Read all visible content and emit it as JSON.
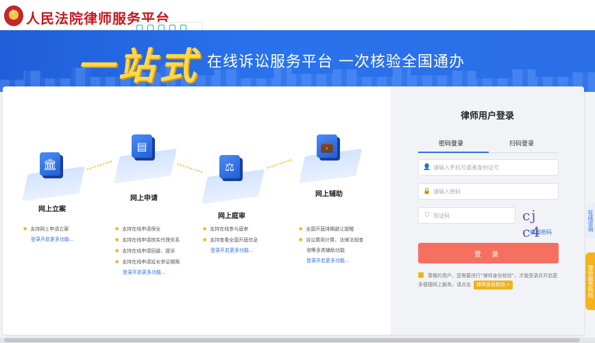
{
  "header": {
    "site_title": "人民法院律师服务平台"
  },
  "banner": {
    "slogan_big": "一站式",
    "slogan_small": "在线诉讼服务平台  一次核验全国通办"
  },
  "features": [
    {
      "title": "网上立案",
      "icon": "bank-icon",
      "bullets": [
        "支持网上申请立案"
      ],
      "more": "登录开启更多功能..."
    },
    {
      "title": "网上申请",
      "icon": "document-icon",
      "bullets": [
        "支持在线申请保全",
        "支持在线申请核实代理关系",
        "支持在线申请回避、提诉",
        "支持在线申请延长举证期限"
      ],
      "more": "登录开启更多功能..."
    },
    {
      "title": "网上庭审",
      "icon": "gavel-icon",
      "bullets": [
        "支持在线参与庭审",
        "支持查看全国开庭信息"
      ],
      "more": "登录开启更多功能..."
    },
    {
      "title": "网上辅助",
      "icon": "briefcase-icon",
      "bullets": [
        "全国开庭排期避让提醒",
        "诉讼费用计算、法律法规查",
        "询等多类辅助功能"
      ],
      "more": "登录开启更多功能..."
    }
  ],
  "login": {
    "title": "律师用户登录",
    "tab_password": "密码登录",
    "tab_scan": "扫码登录",
    "phone_placeholder": "请输入手机号或者身份证号",
    "password_placeholder": "请输入密码",
    "captcha_placeholder": "验证码",
    "captcha_text": "cj c4",
    "refresh_label": "换图密码",
    "login_button": "登 录",
    "notice_text": "尊敬的用户，您需要进行“律师身份核验”，才能登录并开启更多便捷网上服务。请点击",
    "notice_button": "律师身份核验 »"
  },
  "side": {
    "float1": "在线咨询",
    "float2": "律师服务热线"
  },
  "colors": {
    "brand_red": "#c8141c",
    "banner_blue": "#2a6ee6",
    "accent_yellow": "#ffd84a",
    "login_button": "#f6705f"
  }
}
